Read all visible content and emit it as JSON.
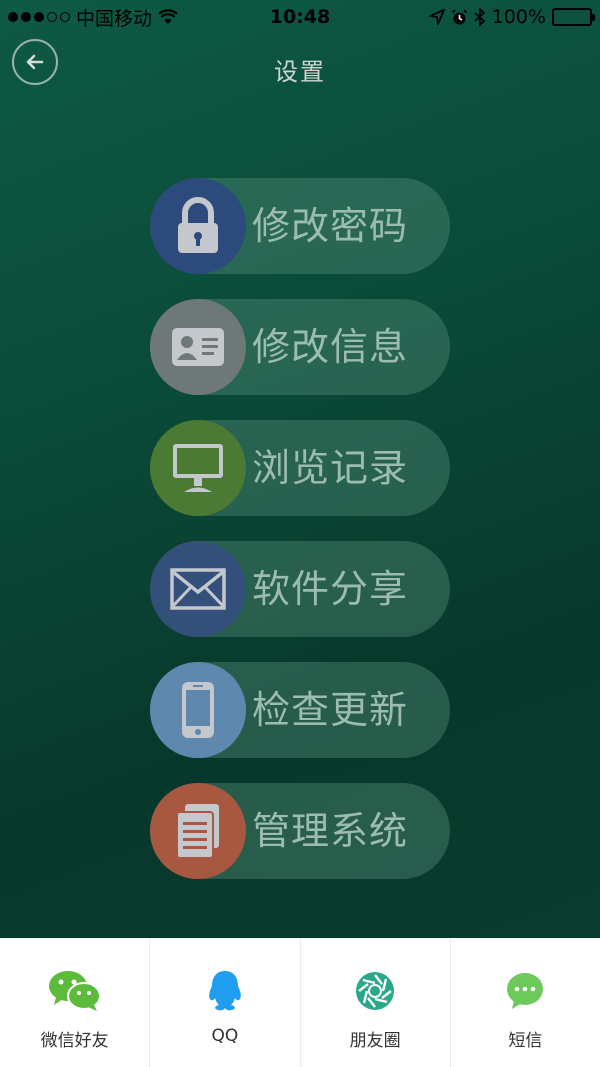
{
  "status_bar": {
    "carrier": "中国移动",
    "time": "10:48",
    "battery": "100%"
  },
  "header": {
    "title": "设置",
    "back_icon": "arrow-left-icon"
  },
  "menu": [
    {
      "label": "修改密码",
      "icon": "lock-icon",
      "color": "#2c4a7c"
    },
    {
      "label": "修改信息",
      "icon": "id-card-icon",
      "color": "#6f7878"
    },
    {
      "label": "浏览记录",
      "icon": "monitor-icon",
      "color": "#4a7a34"
    },
    {
      "label": "软件分享",
      "icon": "envelope-icon",
      "color": "#33507a"
    },
    {
      "label": "检查更新",
      "icon": "phone-icon",
      "color": "#5f88ae"
    },
    {
      "label": "管理系统",
      "icon": "documents-icon",
      "color": "#a85840"
    }
  ],
  "share": [
    {
      "label": "微信好友",
      "icon": "wechat-icon",
      "color": "#5dbb3c"
    },
    {
      "label": "QQ",
      "icon": "qq-icon",
      "color": "#1f9ef0"
    },
    {
      "label": "朋友圈",
      "icon": "moments-icon",
      "color": "#2aa88a"
    },
    {
      "label": "短信",
      "icon": "sms-icon",
      "color": "#6cc95a"
    }
  ]
}
